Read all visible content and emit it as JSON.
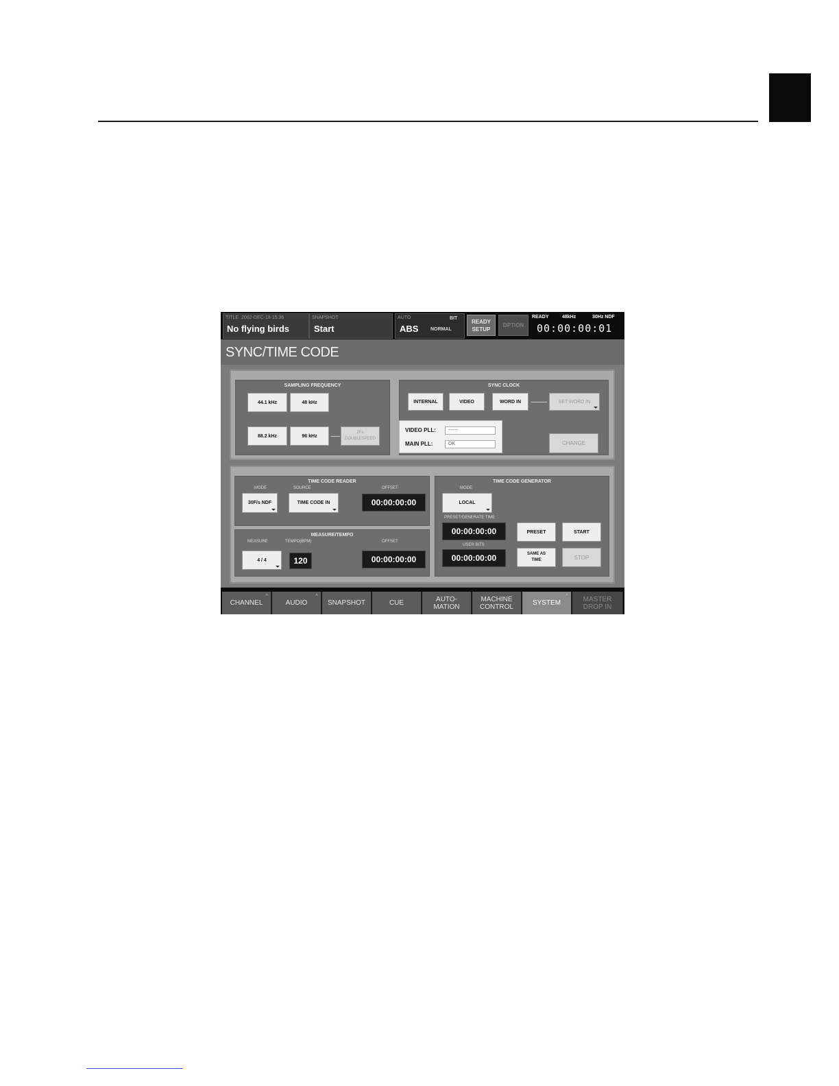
{
  "header": {
    "title_label": "TITLE",
    "title_date": "2002-DEC-18 15:36",
    "title_name": "No flying birds",
    "snapshot_label": "SNAPSHOT",
    "snapshot_name": "Start",
    "auto_label": "AUTO",
    "auto_mode": "ABS",
    "bit_label": "BIT",
    "normal_label": "NORMAL",
    "ready_setup": "READY SETUP",
    "option_label": "OPTION",
    "ready_label": "READY",
    "sample_rate": "48kHz",
    "frame_rate": "30Hz NDF",
    "timecode": "00:00:00:01"
  },
  "page": {
    "title": "SYNC/TIME CODE"
  },
  "sampling": {
    "label": "SAMPLING FREQUENCY",
    "btn_441": "44.1 kHz",
    "btn_48": "48 kHz",
    "btn_882": "88.2 kHz",
    "btn_96": "96 kHz",
    "btn_fs_line1": "2Fs",
    "btn_fs_line2": "DOUBLESPEED"
  },
  "sync_clock": {
    "label": "SYNC CLOCK",
    "internal": "INTERNAL",
    "video": "VIDEO",
    "word_in": "WORD IN",
    "set_word_in": "SET WORD IN",
    "change": "CHANGE"
  },
  "pll": {
    "video_label": "VIDEO PLL:",
    "video_value": "------",
    "main_label": "MAIN PLL:",
    "main_value": "OK"
  },
  "tc_reader": {
    "label": "TIME CODE READER",
    "mode_label": "MODE",
    "mode_value": "30F/s NDF",
    "source_label": "SOURCE",
    "source_value": "TIME CODE IN",
    "offset_label": "OFFSET",
    "offset_value": "00:00:00:00"
  },
  "measure": {
    "label": "MEASURE/TEMPO",
    "measure_label": "MEASURE",
    "measure_value": "4 / 4",
    "tempo_label": "TEMPO(BPM)",
    "tempo_value": "120",
    "offset_label": "OFFSET",
    "offset_value": "00:00:00:00"
  },
  "tc_gen": {
    "label": "TIME CODE GENERATOR",
    "mode_label": "MODE",
    "mode_value": "LOCAL",
    "preset_label": "PRESET/GENERATE TIME",
    "preset_value": "00:00:00:00",
    "userbits_label": "USER BITS",
    "userbits_value": "00:00:00:00",
    "preset_btn": "PRESET",
    "start_btn": "START",
    "same_line1": "SAME AS",
    "same_line2": "TIME",
    "stop_btn": "STOP"
  },
  "tabs": {
    "channel": "CHANNEL",
    "audio": "AUDIO",
    "snapshot": "SNAPSHOT",
    "cue": "CUE",
    "automation_1": "AUTO-",
    "automation_2": "MATION",
    "machine_1": "MACHINE",
    "machine_2": "CONTROL",
    "system": "SYSTEM",
    "master_1": "MASTER",
    "master_2": "DROP IN"
  }
}
